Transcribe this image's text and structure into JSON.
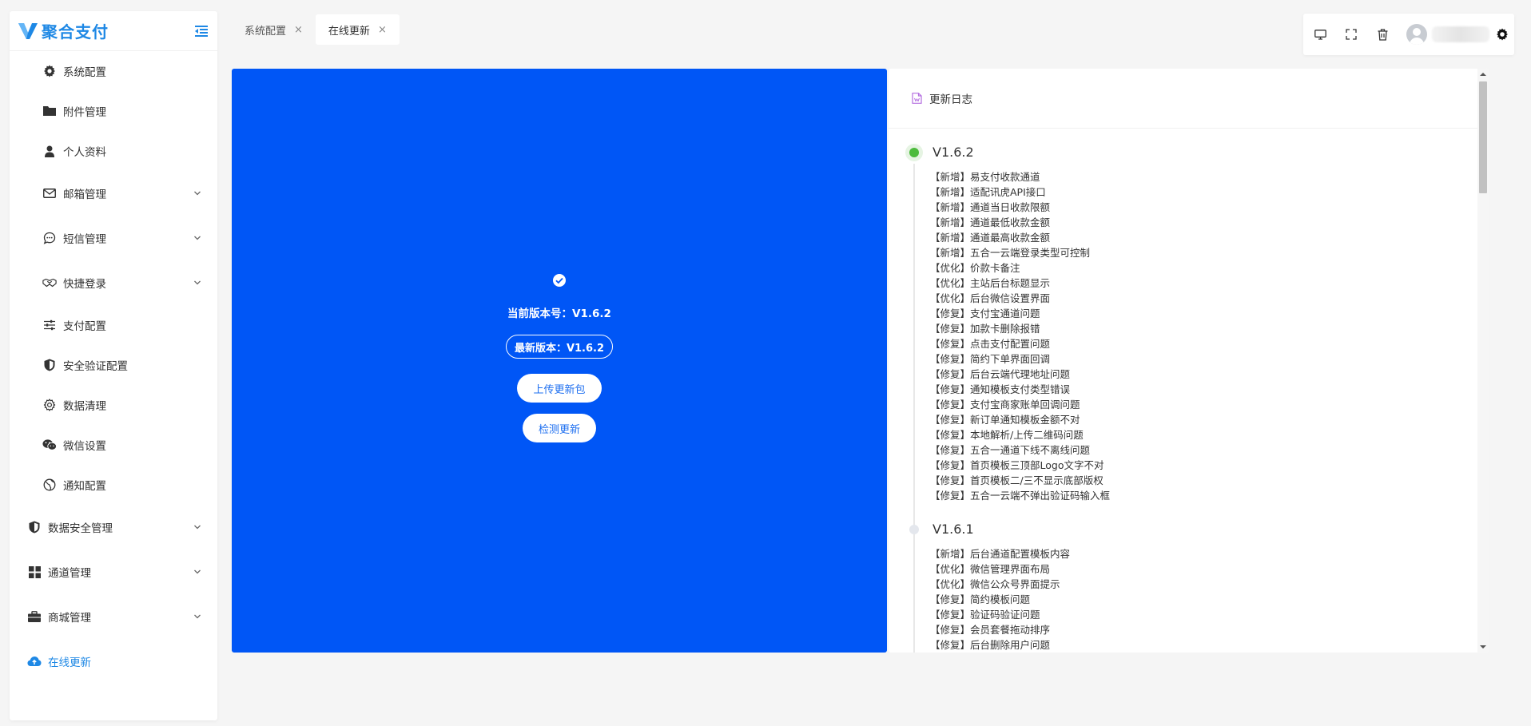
{
  "brand": {
    "name": "聚合支付"
  },
  "sidebar": {
    "items": [
      {
        "label": "系统配置",
        "icon": "gear-icon"
      },
      {
        "label": "附件管理",
        "icon": "folder-icon"
      },
      {
        "label": "个人资料",
        "icon": "user-icon"
      },
      {
        "label": "邮箱管理",
        "icon": "mail-icon"
      },
      {
        "label": "短信管理",
        "icon": "message-icon"
      },
      {
        "label": "快捷登录",
        "icon": "handshake-icon"
      },
      {
        "label": "支付配置",
        "icon": "sliders-icon"
      },
      {
        "label": "安全验证配置",
        "icon": "shield-icon"
      },
      {
        "label": "数据清理",
        "icon": "cog-outline-icon"
      },
      {
        "label": "微信设置",
        "icon": "wechat-icon"
      },
      {
        "label": "通知配置",
        "icon": "globe-icon"
      },
      {
        "label": "数据安全管理",
        "icon": "shield-icon"
      },
      {
        "label": "通道管理",
        "icon": "grid-icon"
      },
      {
        "label": "商城管理",
        "icon": "briefcase-icon"
      },
      {
        "label": "在线更新",
        "icon": "cloud-upload-icon"
      }
    ]
  },
  "tabs": [
    {
      "label": "系统配置",
      "close": "×"
    },
    {
      "label": "在线更新",
      "close": "×"
    }
  ],
  "update": {
    "current_version": "当前版本号：V1.6.2",
    "latest_version": "最新版本：V1.6.2",
    "upload_button": "上传更新包",
    "check_button": "检测更新"
  },
  "changelog": {
    "title": "更新日志",
    "versions": [
      {
        "version": "V1.6.2",
        "items": [
          "【新增】易支付收款通道",
          "【新增】适配讯虎API接口",
          "【新增】通道当日收款限额",
          "【新增】通道最低收款金额",
          "【新增】通道最高收款金额",
          "【新增】五合一云端登录类型可控制",
          "【优化】价款卡备注",
          "【优化】主站后台标题显示",
          "【优化】后台微信设置界面",
          "【修复】支付宝通道问题",
          "【修复】加款卡删除报错",
          "【修复】点击支付配置问题",
          "【修复】简约下单界面回调",
          "【修复】后台云端代理地址问题",
          "【修复】通知模板支付类型错误",
          "【修复】支付宝商家账单回调问题",
          "【修复】新订单通知模板金额不对",
          "【修复】本地解析/上传二维码问题",
          "【修复】五合一通道下线不离线问题",
          "【修复】首页模板三顶部Logo文字不对",
          "【修复】首页模板二/三不显示底部版权",
          "【修复】五合一云端不弹出验证码输入框"
        ]
      },
      {
        "version": "V1.6.1",
        "items": [
          "【新增】后台通道配置模板内容",
          "【优化】微信管理界面布局",
          "【优化】微信公众号界面提示",
          "【修复】简约模板问题",
          "【修复】验证码验证问题",
          "【修复】会员套餐拖动排序",
          "【修复】后台删除用户问题"
        ]
      }
    ]
  },
  "colors": {
    "brand": "#1e88e5",
    "panel_blue": "#0056f6",
    "timeline_active": "#4cbb3c"
  }
}
